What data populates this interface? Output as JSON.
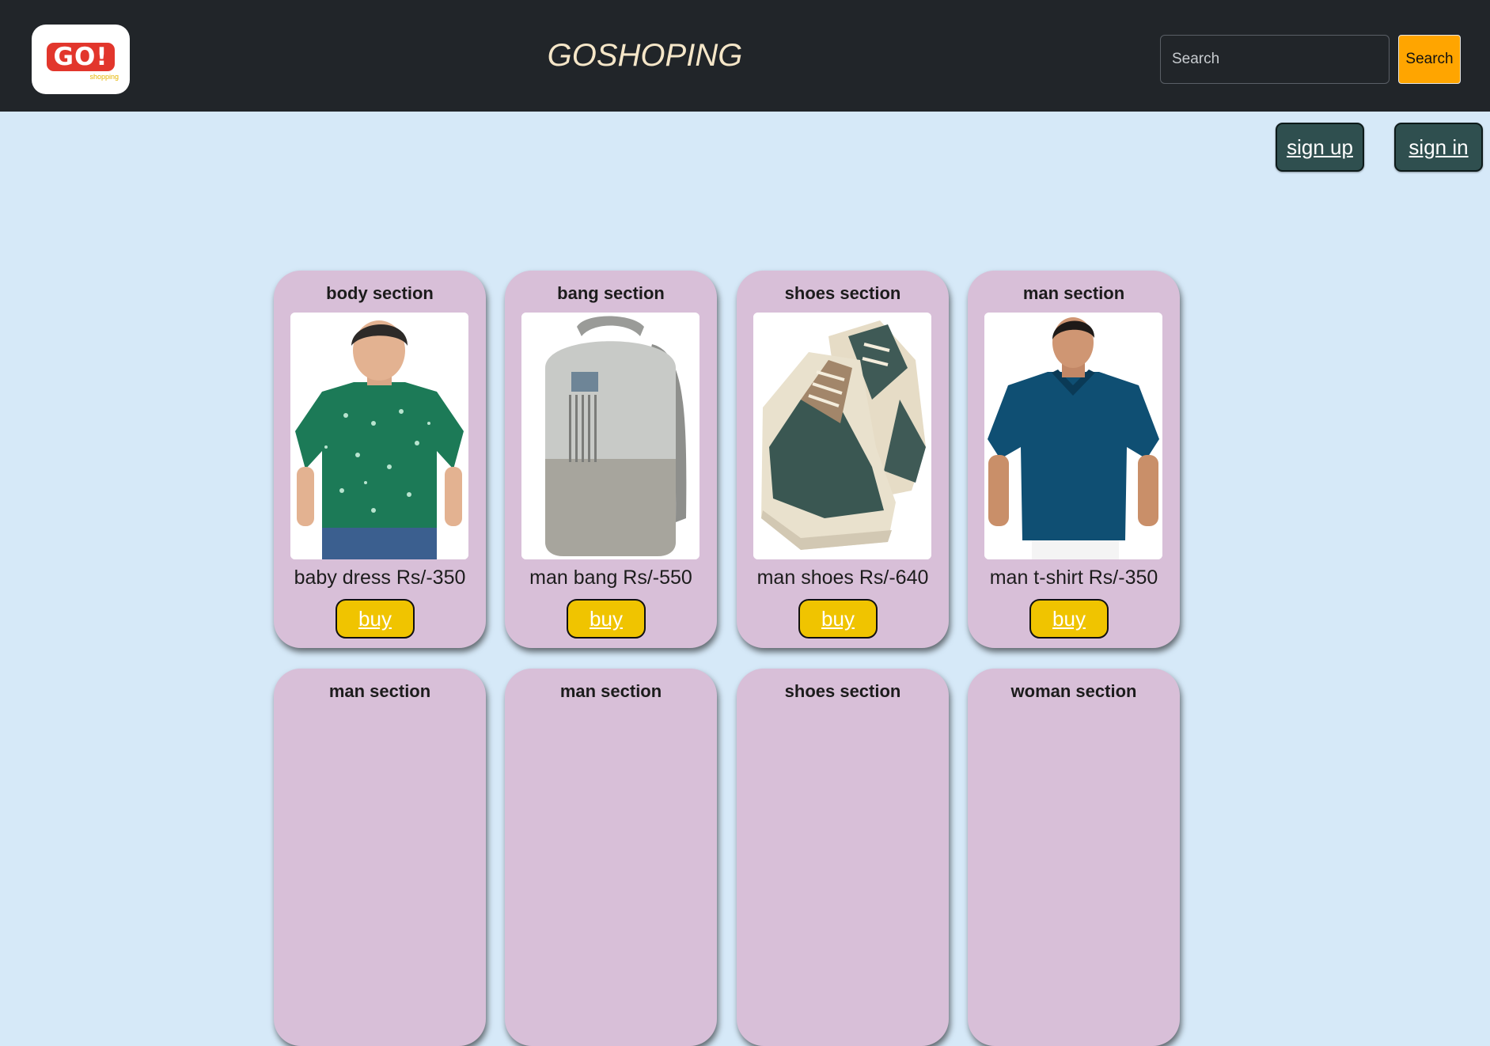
{
  "header": {
    "logo_text": "GO!",
    "logo_subtext": "shopping",
    "brand": "GOSHOPING",
    "search_placeholder": "Search",
    "search_button": "Search"
  },
  "auth": {
    "signup_label": "sign up",
    "signin_label": "sign in"
  },
  "products": [
    {
      "section": "body section",
      "price_text": "baby dress Rs/-350",
      "buy_label": "buy",
      "image": "boy-green-tshirt"
    },
    {
      "section": "bang section",
      "price_text": "man bang Rs/-550",
      "buy_label": "buy",
      "image": "grey-backpack"
    },
    {
      "section": "shoes section",
      "price_text": "man shoes Rs/-640",
      "buy_label": "buy",
      "image": "high-top-sneakers"
    },
    {
      "section": "man section",
      "price_text": "man t-shirt Rs/-350",
      "buy_label": "buy",
      "image": "man-blue-polo"
    },
    {
      "section": "man section"
    },
    {
      "section": "man section"
    },
    {
      "section": "shoes section"
    },
    {
      "section": "woman section"
    }
  ],
  "colors": {
    "header_bg": "#212529",
    "page_bg": "#d6e9f8",
    "card_bg": "#d8bfd8",
    "buy_button": "#f0c400",
    "search_button": "#ffa500",
    "auth_button": "#2f4f4f",
    "logo_red": "#e2362c"
  }
}
